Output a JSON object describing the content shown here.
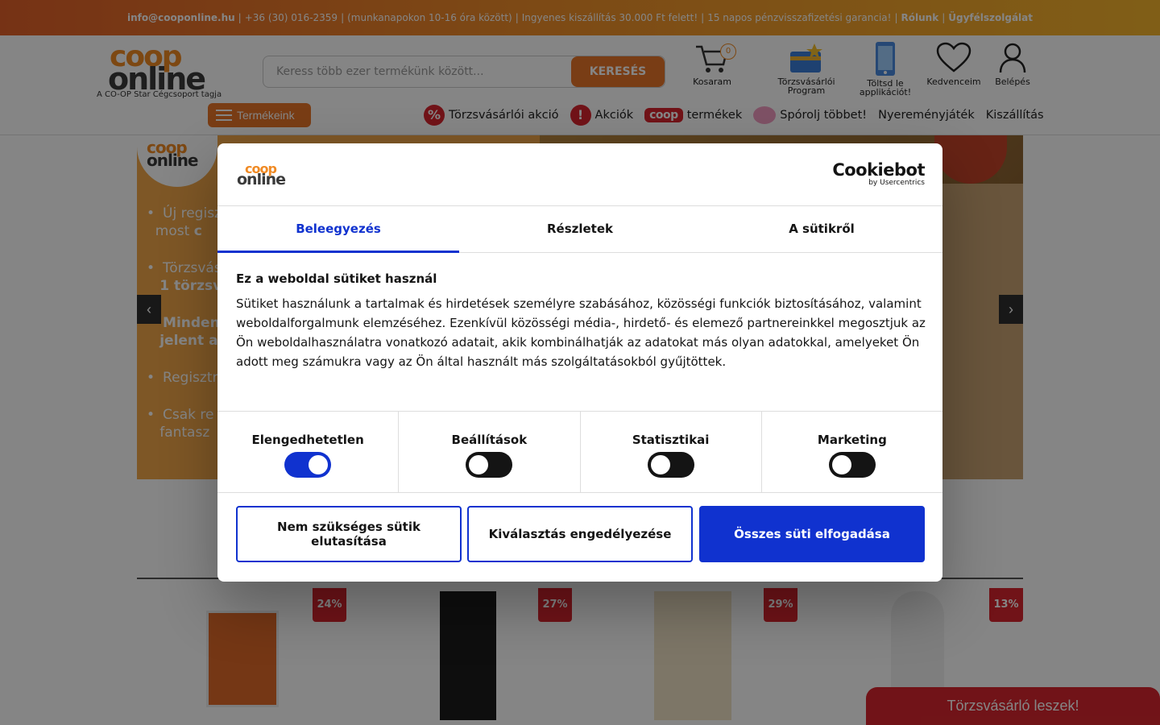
{
  "topbar": {
    "email": "info@cooponline.hu",
    "phone": "+36 (30) 016-2359",
    "hours": "(munkanapokon 10-16 óra között)",
    "shipping": "Ingyenes kiszállítás 30.000 Ft felett!",
    "guarantee": "15 napos pénzvisszafizetési garancia!",
    "about": "Rólunk",
    "support": "Ügyfélszolgálat",
    "separator": "|"
  },
  "header": {
    "logo_top": "coop",
    "logo_bottom": "online",
    "tagline": "A CO-OP Star Cégcsoport tagja",
    "search_placeholder": "Keress több ezer termékünk között...",
    "search_button": "KERESÉS",
    "cart_label": "Kosaram",
    "cart_count": "0",
    "loyalty_label_1": "Törzsvásárlói",
    "loyalty_label_2": "Program",
    "app_label_1": "Töltsd le",
    "app_label_2": "applikációt!",
    "favorites_label": "Kedvenceim",
    "login_label": "Belépés",
    "products_button": "Termékeink"
  },
  "nav": {
    "loyalty_sale": "Törzsvásárlói akció",
    "loyalty_sale_symbol": "%",
    "sales": "Akciók",
    "sales_symbol": "!",
    "coop_pill": "coop",
    "coop_products": "termékek",
    "save_more": "Spórolj többet!",
    "prize_game": "Nyereményjáték",
    "delivery": "Kiszállítás"
  },
  "hero": {
    "logo_top": "coop",
    "logo_bottom": "online",
    "bullets": [
      {
        "a": "Új regisz",
        "b": " most ",
        "bold": "c"
      },
      {
        "a": "Törzsvás",
        "bold": "1 törzsv"
      },
      {
        "bold": "Minden",
        "bold2": "jelent a"
      },
      {
        "a": "Regisztr"
      },
      {
        "a": "Csak re",
        "b": "fantasz"
      }
    ],
    "prev_arrow": "‹",
    "next_arrow": "›"
  },
  "products": [
    {
      "discount": "24%",
      "color": "#e06a2a"
    },
    {
      "discount": "27%",
      "color": "#1c1c1c"
    },
    {
      "discount": "29%",
      "color": "#efe3c6"
    },
    {
      "discount": "13%",
      "color": "#f2f2f2"
    }
  ],
  "loyalty_button": "Törzsvásárló leszek!",
  "cookie": {
    "logo_top": "coop",
    "logo_bottom": "online",
    "brand": "Cookiebot",
    "brand_sub": "by Usercentrics",
    "tabs": [
      "Beleegyezés",
      "Részletek",
      "A sütikről"
    ],
    "active_tab": 0,
    "title": "Ez a weboldal sütiket használ",
    "body": "Sütiket használunk a tartalmak és hirdetések személyre szabásához, közösségi funkciók biztosításához, valamint weboldalforgalmunk elemzéséhez. Ezenkívül közösségi média-, hirdető- és elemező partnereinkkel megosztjuk az Ön weboldalhasználatra vonatkozó adatait, akik kombinálhatják az adatokat más olyan adatokkal, amelyeket Ön adott meg számukra vagy az Ön által használt más szolgáltatásokból gyűjtöttek.",
    "toggles": [
      {
        "label": "Elengedhetetlen",
        "on": true
      },
      {
        "label": "Beállítások",
        "on": false
      },
      {
        "label": "Statisztikai",
        "on": false
      },
      {
        "label": "Marketing",
        "on": false
      }
    ],
    "btn_reject": "Nem szükséges sütik elutasítása",
    "btn_selection": "Kiválasztás engedélyezése",
    "btn_accept_all": "Összes süti elfogadása",
    "accent": "#1032cf"
  }
}
